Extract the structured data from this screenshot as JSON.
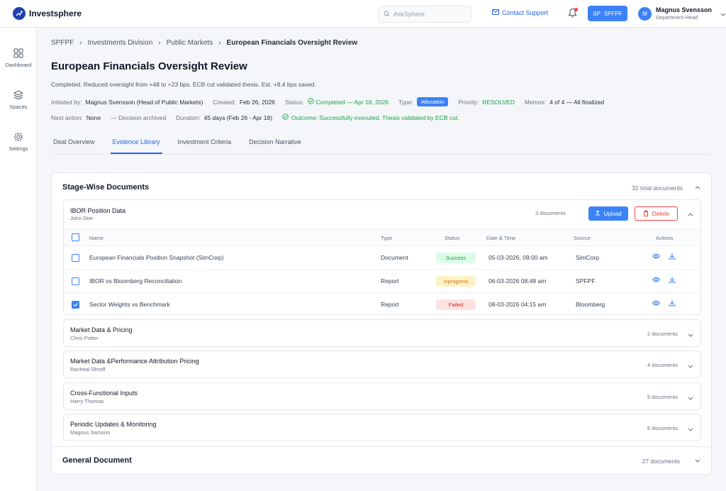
{
  "app": {
    "name": "Investsphere"
  },
  "header": {
    "search_placeholder": "AskSphere",
    "contact_label": "Contact Support",
    "org_initials": "SP",
    "org_label": "SPFPF",
    "user_initial": "M",
    "user_name": "Magnus Svensson",
    "user_role": "Department Head"
  },
  "sidebar": {
    "items": [
      {
        "label": "Dashboard",
        "icon": "grid-icon"
      },
      {
        "label": "Spaces",
        "icon": "layers-icon"
      },
      {
        "label": "Settings",
        "icon": "gear-icon"
      }
    ]
  },
  "breadcrumb": [
    "SPFPF",
    "Investments Division",
    "Public Markets",
    "European Financials Oversight Review"
  ],
  "page": {
    "title": "European Financials Oversight Review",
    "summary": "Completed. Reduced oversight from +48 to +23 bps. ECB cut validated thesis. Est. +8.4 bps saved.",
    "initiated_label": "Initiated by:",
    "initiated_value": "Magnus Svensson (Head of Public Markets)",
    "created_label": "Created:",
    "created_value": "Feb 26, 2026",
    "status_label": "Status:",
    "status_value": "Completed — Apr 18, 2026",
    "type_label": "Type:",
    "type_value": "Allocation",
    "priority_label": "Priority:",
    "priority_value": "RESOLVED",
    "memos_label": "Memos:",
    "memos_value": "4 of 4 — All finalized",
    "next_label": "Next action:",
    "next_value": "None",
    "decision_value": "— Decision archived",
    "duration_label": "Duration:",
    "duration_value": "45 days (Feb 26 - Apr 18)",
    "outcome_value": "Outcome: Successfully executed. Thesis validated by ECB cut."
  },
  "tabs": [
    "Deal Overview",
    "Evidence Library",
    "Investment Criteria",
    "Decision Narrative"
  ],
  "stage_docs": {
    "title": "Stage-Wise Documents",
    "count": "32 total documents",
    "expanded_group": {
      "title": "IBOR Position Data",
      "owner": "John Doe",
      "count": "3 documents",
      "upload_label": "Upload",
      "delete_label": "Delete",
      "columns": [
        "Name",
        "Type",
        "Status",
        "Date & Time",
        "Source",
        "Actions"
      ],
      "rows": [
        {
          "name": "European Financials Position Snapshot (SimCorp)",
          "type": "Document",
          "status": "Success",
          "datetime": "05-03-2026, 09:00 am",
          "source": "SimCorp"
        },
        {
          "name": "IBOR vs Bloomberg Reconciliation",
          "type": "Report",
          "status": "Inprogress",
          "datetime": "06-03-2026 08:48 am",
          "source": "SPFPF"
        },
        {
          "name": "Sector Weights vs Benchmark",
          "type": "Report",
          "status": "Failed",
          "datetime": "08-03-2026 04:15 am",
          "source": "Bloomberg"
        }
      ]
    },
    "groups": [
      {
        "title": "Market Data & Pricing",
        "owner": "Chris Potter",
        "count": "2 documents"
      },
      {
        "title": "Market Data &Performance Attribution Pricing",
        "owner": "Racheal Shroff",
        "count": "4 documents"
      },
      {
        "title": "Cross-Functional Inputs",
        "owner": "Harry Thomas",
        "count": "5 documents"
      },
      {
        "title": "Periodic Updates & Monitoring",
        "owner": "Magnus Samson",
        "count": "6 documents"
      }
    ]
  },
  "general_doc": {
    "title": "General Document",
    "count": "27 documents"
  },
  "colors": {
    "accent": "#3b82f6",
    "success": "#16a34a",
    "danger": "#ef4444",
    "warning": "#d97706"
  }
}
